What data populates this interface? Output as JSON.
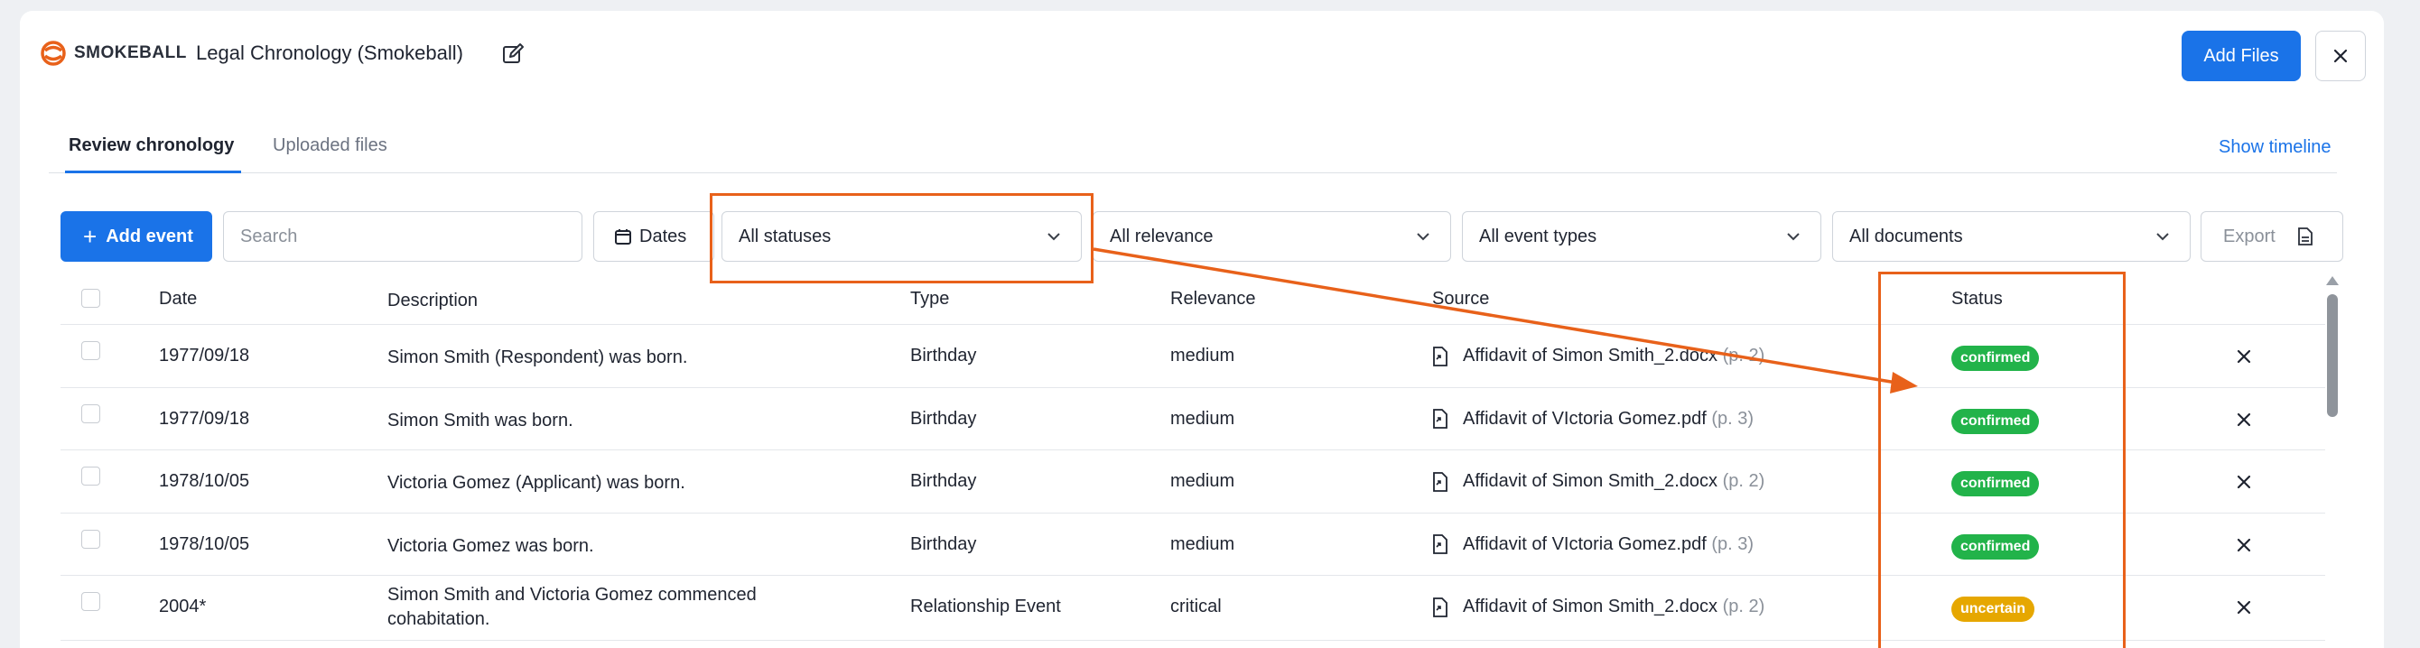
{
  "header": {
    "brand": "SMOKEBALL",
    "title": "Legal Chronology (Smokeball)",
    "add_files_label": "Add Files"
  },
  "tabs": [
    {
      "label": "Review chronology",
      "active": true
    },
    {
      "label": "Uploaded files",
      "active": false
    }
  ],
  "show_timeline_label": "Show timeline",
  "toolbar": {
    "add_event_label": "Add event",
    "search_placeholder": "Search",
    "dates_label": "Dates",
    "filters": {
      "status": "All statuses",
      "relevance": "All relevance",
      "event_types": "All event types",
      "documents": "All documents"
    },
    "export_label": "Export"
  },
  "table": {
    "columns": [
      "Date",
      "Description",
      "Type",
      "Relevance",
      "Source",
      "Status"
    ],
    "rows": [
      {
        "date": "1977/09/18",
        "description": "Simon Smith (Respondent) was born.",
        "type": "Birthday",
        "relevance": "medium",
        "source": "Affidavit of Simon Smith_2.docx",
        "page": "(p. 2)",
        "status": "confirmed"
      },
      {
        "date": "1977/09/18",
        "description": "Simon Smith was born.",
        "type": "Birthday",
        "relevance": "medium",
        "source": "Affidavit of VIctoria Gomez.pdf",
        "page": "(p. 3)",
        "status": "confirmed"
      },
      {
        "date": "1978/10/05",
        "description": "Victoria Gomez (Applicant) was born.",
        "type": "Birthday",
        "relevance": "medium",
        "source": "Affidavit of Simon Smith_2.docx",
        "page": "(p. 2)",
        "status": "confirmed"
      },
      {
        "date": "1978/10/05",
        "description": "Victoria Gomez was born.",
        "type": "Birthday",
        "relevance": "medium",
        "source": "Affidavit of VIctoria Gomez.pdf",
        "page": "(p. 3)",
        "status": "confirmed"
      },
      {
        "date": "2004*",
        "description": "Simon Smith and Victoria Gomez commenced cohabitation.",
        "type": "Relationship Event",
        "relevance": "critical",
        "source": "Affidavit of Simon Smith_2.docx",
        "page": "(p. 2)",
        "status": "uncertain"
      }
    ]
  },
  "colors": {
    "accent": "#1a73e8",
    "confirmed": "#22b34a",
    "uncertain": "#e6a700",
    "annotation": "#e8611a",
    "brand": "#e8611a"
  }
}
